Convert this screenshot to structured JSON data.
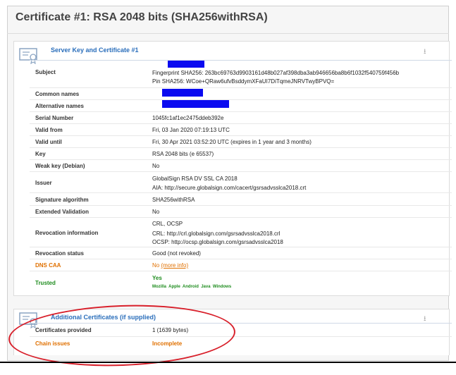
{
  "page": {
    "title": "Certificate #1: RSA 2048 bits (SHA256withRSA)"
  },
  "section_main": {
    "title": "Server Key and Certificate #1",
    "rows": {
      "subject": {
        "label": "Subject",
        "fingerprint": "Fingerprint SHA256: 263bc69763d9903161d48b027af398dba3ab946656ba8b6f1032f540759f456b",
        "pin": "Pin SHA256: WCoe+QRaw6ufvBsddymXFaUI7DiTqmeJNRVTwyBPVQ="
      },
      "common_names": {
        "label": "Common names"
      },
      "alternative_names": {
        "label": "Alternative names"
      },
      "serial_number": {
        "label": "Serial Number",
        "value": "1045fc1af1ec2475ddeb392e"
      },
      "valid_from": {
        "label": "Valid from",
        "value": "Fri, 03 Jan 2020 07:19:13 UTC"
      },
      "valid_until": {
        "label": "Valid until",
        "value": "Fri, 30 Apr 2021 03:52:20 UTC (expires in 1 year and 3 months)"
      },
      "key": {
        "label": "Key",
        "value": "RSA 2048 bits (e 65537)"
      },
      "weak_key": {
        "label": "Weak key (Debian)",
        "value": "No"
      },
      "issuer": {
        "label": "Issuer",
        "value": "GlobalSign RSA DV SSL CA 2018",
        "aia": "AIA: http://secure.globalsign.com/cacert/gsrsadvsslca2018.crt"
      },
      "signature_algorithm": {
        "label": "Signature algorithm",
        "value": "SHA256withRSA"
      },
      "extended_validation": {
        "label": "Extended Validation",
        "value": "No"
      },
      "revocation_information": {
        "label": "Revocation information",
        "value": "CRL, OCSP",
        "crl": "CRL: http://crl.globalsign.com/gsrsadvsslca2018.crl",
        "ocsp": "OCSP: http://ocsp.globalsign.com/gsrsadvsslca2018"
      },
      "revocation_status": {
        "label": "Revocation status",
        "value": "Good (not revoked)"
      },
      "dns_caa": {
        "label": "DNS CAA",
        "value": "No",
        "link": "(more info)"
      },
      "trusted": {
        "label": "Trusted",
        "value": "Yes",
        "stores": "Mozilla  Apple  Android  Java  Windows"
      }
    }
  },
  "section_additional": {
    "title": "Additional Certificates (if supplied)",
    "rows": {
      "certificates_provided": {
        "label": "Certificates provided",
        "value": "1 (1639 bytes)"
      },
      "chain_issues": {
        "label": "Chain issues",
        "value": "Incomplete"
      }
    }
  },
  "colors": {
    "accent": "#2a6ebb",
    "warning": "#e07000",
    "ok": "#1e8c1e",
    "redaction": "#0a0af0",
    "annotation": "#d81f2a"
  }
}
